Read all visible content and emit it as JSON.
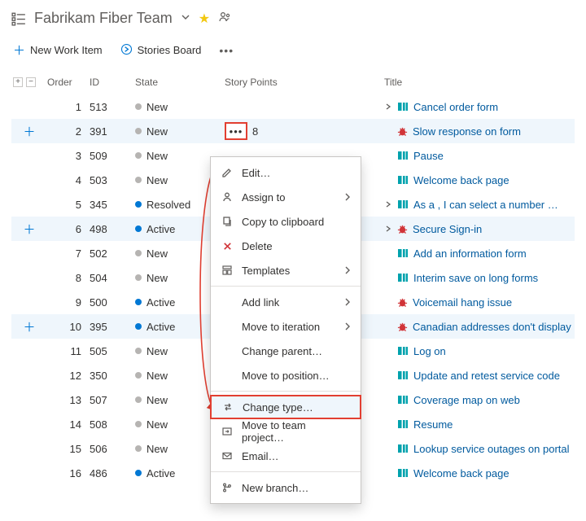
{
  "header": {
    "team_name": "Fabrikam Fiber Team"
  },
  "toolbar": {
    "new_item": "New Work Item",
    "stories_board": "Stories Board"
  },
  "columns": {
    "order": "Order",
    "id": "ID",
    "state": "State",
    "story_points": "Story Points",
    "title": "Title"
  },
  "rows": [
    {
      "order": "1",
      "id": "513",
      "state": "New",
      "sp": "",
      "title": "Cancel order form",
      "type": "story",
      "expand": true
    },
    {
      "order": "2",
      "id": "391",
      "state": "New",
      "sp": "8",
      "title": "Slow response on form",
      "type": "bug",
      "selected": true
    },
    {
      "order": "3",
      "id": "509",
      "state": "New",
      "sp": "",
      "title": "Pause",
      "type": "story"
    },
    {
      "order": "4",
      "id": "503",
      "state": "New",
      "sp": "",
      "title": "Welcome back page",
      "type": "story"
    },
    {
      "order": "5",
      "id": "345",
      "state": "Resolved",
      "sp": "",
      "title": "As a <user>, I can select a number …",
      "type": "story",
      "expand": true
    },
    {
      "order": "6",
      "id": "498",
      "state": "Active",
      "sp": "",
      "title": "Secure Sign-in",
      "type": "bug",
      "expand": true,
      "selected2": true
    },
    {
      "order": "7",
      "id": "502",
      "state": "New",
      "sp": "",
      "title": "Add an information form",
      "type": "story"
    },
    {
      "order": "8",
      "id": "504",
      "state": "New",
      "sp": "",
      "title": "Interim save on long forms",
      "type": "story"
    },
    {
      "order": "9",
      "id": "500",
      "state": "Active",
      "sp": "",
      "title": "Voicemail hang issue",
      "type": "bug"
    },
    {
      "order": "10",
      "id": "395",
      "state": "Active",
      "sp": "",
      "title": "Canadian addresses don't display",
      "type": "bug",
      "selected2": true
    },
    {
      "order": "11",
      "id": "505",
      "state": "New",
      "sp": "",
      "title": "Log on",
      "type": "story"
    },
    {
      "order": "12",
      "id": "350",
      "state": "New",
      "sp": "",
      "title": "Update and retest service code",
      "type": "story"
    },
    {
      "order": "13",
      "id": "507",
      "state": "New",
      "sp": "",
      "title": "Coverage map on web",
      "type": "story"
    },
    {
      "order": "14",
      "id": "508",
      "state": "New",
      "sp": "",
      "title": "Resume",
      "type": "story"
    },
    {
      "order": "15",
      "id": "506",
      "state": "New",
      "sp": "",
      "title": "Lookup service outages on portal",
      "type": "story"
    },
    {
      "order": "16",
      "id": "486",
      "state": "Active",
      "sp": "",
      "title": "Welcome back page",
      "type": "story"
    }
  ],
  "menu": [
    {
      "icon": "edit",
      "label": "Edit…"
    },
    {
      "icon": "person",
      "label": "Assign to",
      "sub": true
    },
    {
      "icon": "copy",
      "label": "Copy to clipboard"
    },
    {
      "icon": "delete",
      "label": "Delete",
      "red": true
    },
    {
      "icon": "templates",
      "label": "Templates",
      "sub": true
    },
    {
      "sep": true
    },
    {
      "icon": "",
      "label": "Add link",
      "sub": true
    },
    {
      "icon": "",
      "label": "Move to iteration",
      "sub": true
    },
    {
      "icon": "",
      "label": "Change parent…"
    },
    {
      "icon": "",
      "label": "Move to position…"
    },
    {
      "sep": true
    },
    {
      "icon": "swap",
      "label": "Change type…",
      "outlined": true
    },
    {
      "icon": "moveproj",
      "label": "Move to team project…"
    },
    {
      "icon": "mail",
      "label": "Email…"
    },
    {
      "sep": true
    },
    {
      "icon": "branch",
      "label": "New branch…"
    }
  ]
}
